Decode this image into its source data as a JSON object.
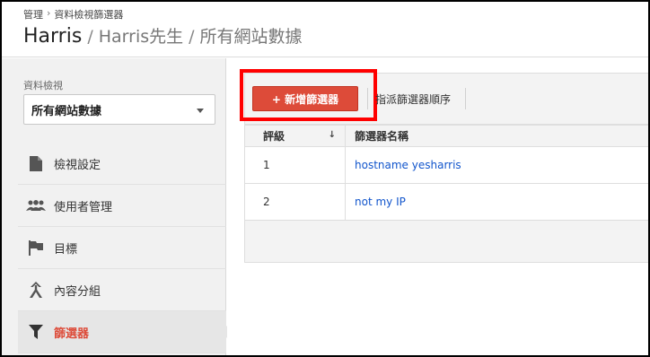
{
  "header": {
    "breadcrumb": [
      "管理",
      "資料檢視篩選器"
    ],
    "title": "Harris",
    "subtitle_account": "Harris先生",
    "subtitle_view": "所有網站數據"
  },
  "sidebar": {
    "view_label": "資料檢視",
    "view_selected": "所有網站數據",
    "items": [
      {
        "label": "檢視設定",
        "icon": "document-icon"
      },
      {
        "label": "使用者管理",
        "icon": "users-icon"
      },
      {
        "label": "目標",
        "icon": "flag-icon"
      },
      {
        "label": "內容分組",
        "icon": "content-grouping-icon"
      },
      {
        "label": "篩選器",
        "icon": "filter-icon",
        "active": true
      }
    ]
  },
  "toolbar": {
    "add_label": "+ 新增篩選器",
    "assign_label": "指派篩選器順序"
  },
  "table": {
    "columns": [
      "評級",
      "篩選器名稱"
    ],
    "sort_indicator": "↓",
    "rows": [
      {
        "rank": "1",
        "name": "hostname yesharris"
      },
      {
        "rank": "2",
        "name": "not my IP"
      }
    ]
  },
  "colors": {
    "accent": "#dd4b39",
    "link": "#1155cc",
    "highlight": "#ff0000"
  }
}
